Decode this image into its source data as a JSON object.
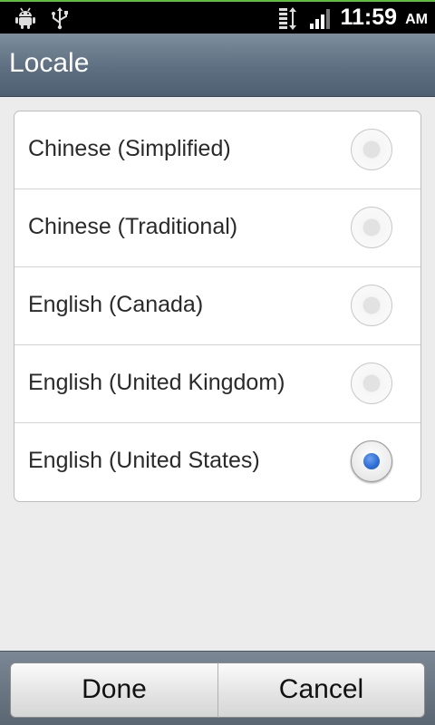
{
  "status_bar": {
    "time": "11:59",
    "ampm": "AM",
    "icons": [
      "android-debug-icon",
      "usb-icon",
      "data-transfer-icon",
      "signal-icon"
    ]
  },
  "title_bar": {
    "title": "Locale"
  },
  "locales": [
    {
      "label": "Chinese (Simplified)",
      "selected": false
    },
    {
      "label": "Chinese (Traditional)",
      "selected": false
    },
    {
      "label": "English (Canada)",
      "selected": false
    },
    {
      "label": "English (United Kingdom)",
      "selected": false
    },
    {
      "label": "English (United States)",
      "selected": true
    }
  ],
  "buttons": {
    "done_label": "Done",
    "cancel_label": "Cancel"
  },
  "colors": {
    "accent_green": "#5fbf3a",
    "radio_selected": "#2f6fd8",
    "title_bar": "#5d6f80"
  }
}
